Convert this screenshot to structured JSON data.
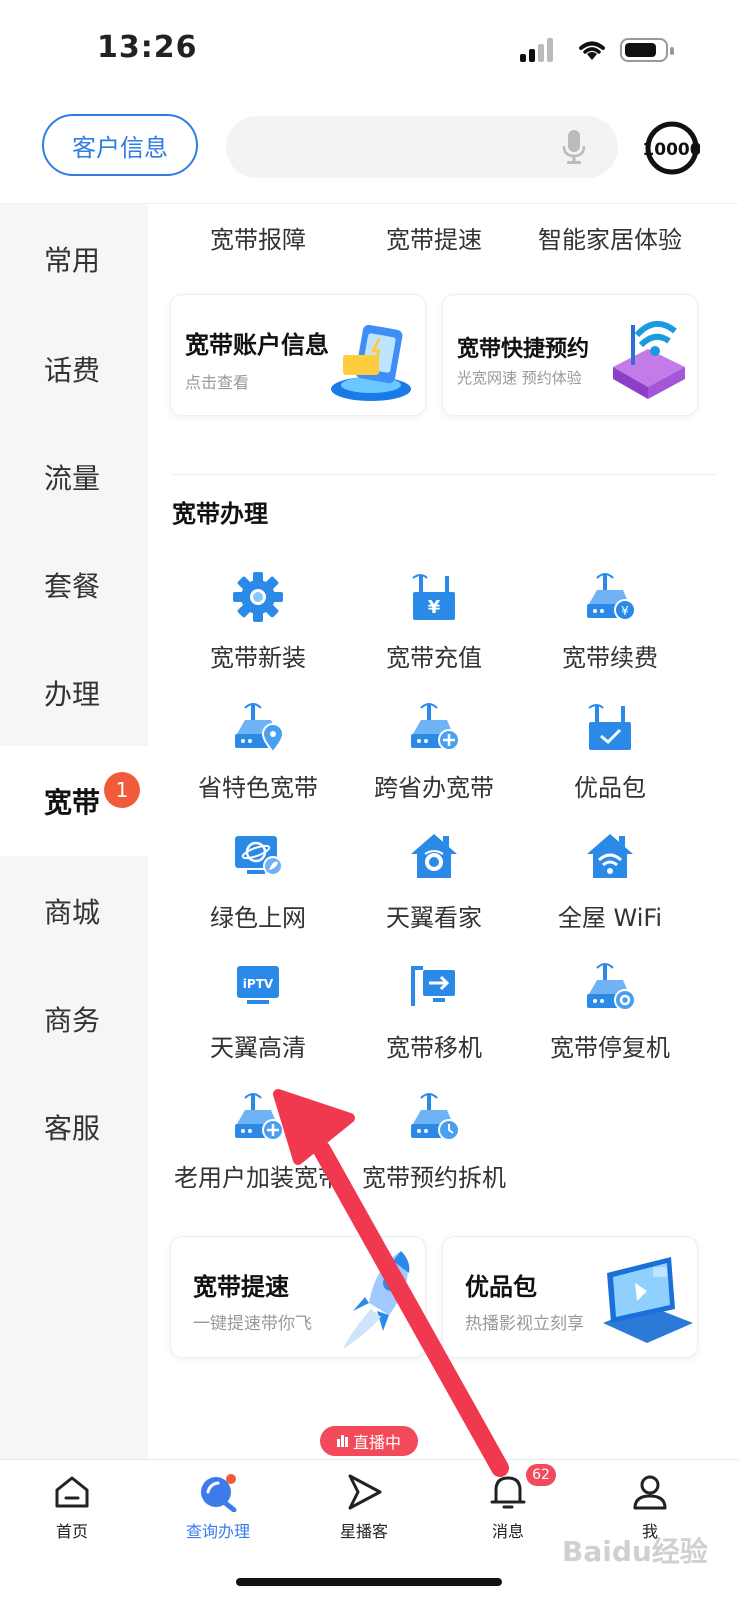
{
  "status_bar": {
    "time": "13:26"
  },
  "header": {
    "customer_info_label": "客户信息",
    "hotline_logo_text": "10000"
  },
  "sidebar": {
    "items": [
      {
        "label": "常用"
      },
      {
        "label": "话费"
      },
      {
        "label": "流量"
      },
      {
        "label": "套餐"
      },
      {
        "label": "办理"
      },
      {
        "label": "宽带",
        "active": true,
        "badge": "1"
      },
      {
        "label": "商城"
      },
      {
        "label": "商务"
      },
      {
        "label": "客服"
      }
    ]
  },
  "top_row": [
    "宽带报障",
    "宽带提速",
    "智能家居体验"
  ],
  "cards_top": [
    {
      "title": "宽带账户信息",
      "subtitle": "点击查看"
    },
    {
      "title": "宽带快捷预约",
      "subtitle": "光宽网速 预约体验"
    }
  ],
  "section": {
    "title": "宽带办理",
    "items": [
      {
        "label": "宽带新装",
        "icon": "gear-icon"
      },
      {
        "label": "宽带充值",
        "icon": "router-yuan-icon"
      },
      {
        "label": "宽带续费",
        "icon": "router-renew-icon"
      },
      {
        "label": "省特色宽带",
        "icon": "router-location-icon"
      },
      {
        "label": "跨省办宽带",
        "icon": "router-plus-icon"
      },
      {
        "label": "优品包",
        "icon": "router-check-icon"
      },
      {
        "label": "绿色上网",
        "icon": "monitor-leaf-icon"
      },
      {
        "label": "天翼看家",
        "icon": "home-camera-icon"
      },
      {
        "label": "全屋 WiFi",
        "icon": "home-wifi-icon"
      },
      {
        "label": "天翼高清",
        "icon": "iptv-icon"
      },
      {
        "label": "宽带移机",
        "icon": "move-router-icon"
      },
      {
        "label": "宽带停复机",
        "icon": "router-settings-icon"
      },
      {
        "label": "老用户加装宽带",
        "icon": "router-add-icon"
      },
      {
        "label": "宽带预约拆机",
        "icon": "router-clock-icon"
      }
    ]
  },
  "cards_bottom": [
    {
      "title": "宽带提速",
      "subtitle": "一键提速带你飞"
    },
    {
      "title": "优品包",
      "subtitle": "热播影视立刻享"
    }
  ],
  "tabbar": {
    "live_badge": "直播中",
    "message_count": "62",
    "items": [
      {
        "label": "首页"
      },
      {
        "label": "查询办理",
        "active": true
      },
      {
        "label": "星播客"
      },
      {
        "label": "消息"
      },
      {
        "label": "我"
      }
    ]
  },
  "watermark": "Baidu经验",
  "colors": {
    "accent": "#2f7de0",
    "badge": "#f25b3a",
    "arrow": "#f0384e",
    "icon_blue": "#2b8ae8"
  }
}
